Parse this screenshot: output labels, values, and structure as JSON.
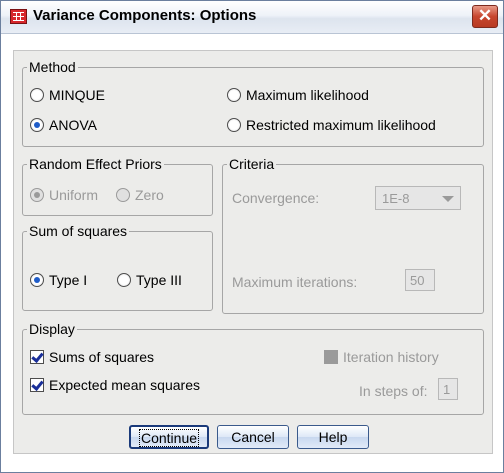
{
  "window": {
    "title": "Variance Components: Options",
    "close_glyph": "✕",
    "icon": "spss-table-icon"
  },
  "method": {
    "legend": "Method",
    "options": [
      {
        "label": "MINQUE",
        "selected": false
      },
      {
        "label": "Maximum likelihood",
        "selected": false
      },
      {
        "label": "ANOVA",
        "selected": true
      },
      {
        "label": "Restricted maximum likelihood",
        "selected": false
      }
    ]
  },
  "priors": {
    "legend": "Random Effect Priors",
    "options": [
      {
        "label": "Uniform",
        "selected": true,
        "enabled": false
      },
      {
        "label": "Zero",
        "selected": false,
        "enabled": false
      }
    ]
  },
  "criteria": {
    "legend": "Criteria",
    "convergence_label": "Convergence:",
    "convergence_value": "1E-8",
    "max_iter_label": "Maximum iterations:",
    "max_iter_value": "50"
  },
  "sum_squares": {
    "legend": "Sum of squares",
    "options": [
      {
        "label": "Type I",
        "selected": true
      },
      {
        "label": "Type III",
        "selected": false
      }
    ]
  },
  "display": {
    "legend": "Display",
    "sums_label": "Sums of squares",
    "sums_checked": true,
    "expected_label": "Expected mean squares",
    "expected_checked": true,
    "iteration_label": "Iteration history",
    "iteration_checked": false,
    "steps_label": "In steps of:",
    "steps_value": "1"
  },
  "buttons": {
    "continue": "Continue",
    "cancel": "Cancel",
    "help": "Help"
  },
  "colors": {
    "accent": "#1f5cc8",
    "close": "#c7452e"
  }
}
